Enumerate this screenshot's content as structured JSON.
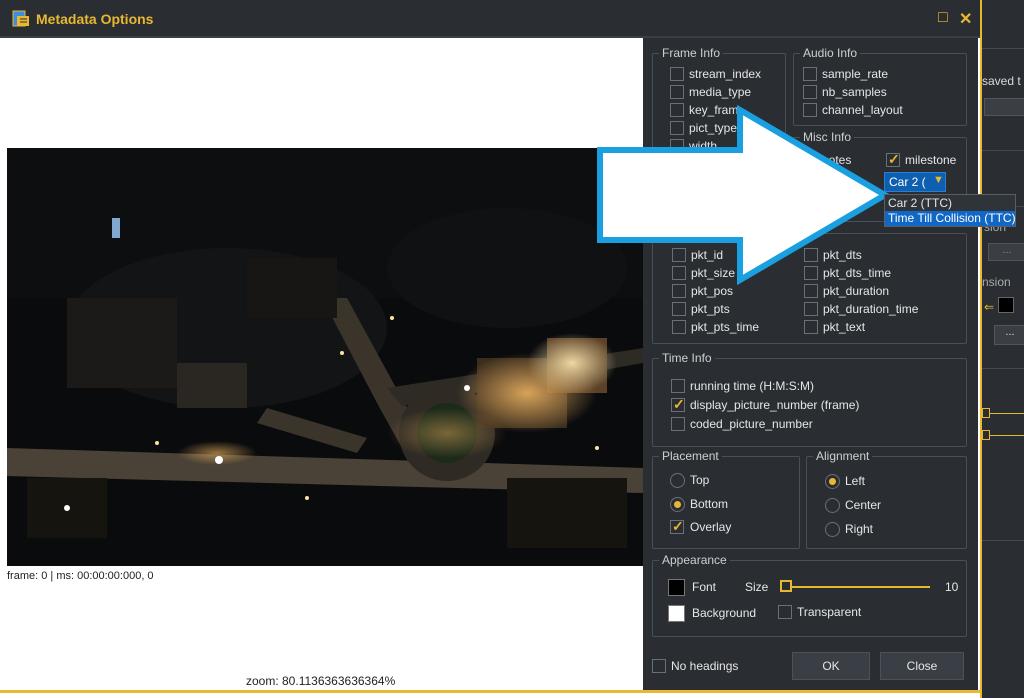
{
  "window": {
    "title": "Metadata Options",
    "maximize_glyph": "□",
    "close_glyph": "✕",
    "icon": "document-icon"
  },
  "background_app": {
    "saved_text": "saved t",
    "sion_text": "sion",
    "nsion_text": "nsion",
    "dots_1": "...",
    "dots_2": "..."
  },
  "preview": {
    "frame_info": "frame: 0 | ms: 00:00:00:000, 0",
    "zoom": "zoom: 80.1136363636364%"
  },
  "frame_info": {
    "heading": "Frame Info",
    "items": [
      {
        "label": "stream_index",
        "checked": false
      },
      {
        "label": "media_type",
        "checked": false
      },
      {
        "label": "key_fram",
        "checked": false
      },
      {
        "label": "pict_type",
        "checked": false
      },
      {
        "label": "width",
        "checked": false
      }
    ]
  },
  "audio_info": {
    "heading": "Audio Info",
    "items": [
      {
        "label": "sample_rate",
        "checked": false
      },
      {
        "label": "nb_samples",
        "checked": false
      },
      {
        "label": "channel_layout",
        "checked": false
      }
    ]
  },
  "misc_info": {
    "heading": "Misc Info",
    "notes_label": "notes",
    "milestone_label": "milestone",
    "milestone_checked": true,
    "dropdown_value": "Car 2 (",
    "dropdown_options": [
      "Car 2 (TTC)",
      "Time Till Collision (TTC)"
    ],
    "selected_option_index": 1
  },
  "packet_info": {
    "left": [
      {
        "label": "pkt_id",
        "checked": false
      },
      {
        "label": "pkt_size",
        "checked": false
      },
      {
        "label": "pkt_pos",
        "checked": false
      },
      {
        "label": "pkt_pts",
        "checked": false
      },
      {
        "label": "pkt_pts_time",
        "checked": false
      }
    ],
    "right": [
      {
        "label": "pkt_dts",
        "checked": false
      },
      {
        "label": "pkt_dts_time",
        "checked": false
      },
      {
        "label": "pkt_duration",
        "checked": false
      },
      {
        "label": "pkt_duration_time",
        "checked": false
      },
      {
        "label": "pkt_text",
        "checked": false
      }
    ]
  },
  "time_info": {
    "heading": "Time Info",
    "items": [
      {
        "label": "running time (H:M:S:M)",
        "checked": false
      },
      {
        "label": "display_picture_number (frame)",
        "checked": true
      },
      {
        "label": "coded_picture_number",
        "checked": false
      }
    ]
  },
  "placement": {
    "heading": "Placement",
    "options": [
      {
        "label": "Top",
        "selected": false
      },
      {
        "label": "Bottom",
        "selected": true
      }
    ],
    "overlay_label": "Overlay",
    "overlay_checked": true
  },
  "alignment": {
    "heading": "Alignment",
    "options": [
      {
        "label": "Left",
        "selected": true
      },
      {
        "label": "Center",
        "selected": false
      },
      {
        "label": "Right",
        "selected": false
      }
    ]
  },
  "appearance": {
    "heading": "Appearance",
    "font_label": "Font",
    "size_label": "Size",
    "size_value": "10",
    "background_label": "Background",
    "transparent_label": "Transparent",
    "transparent_checked": false
  },
  "footer": {
    "no_headings_label": "No headings",
    "ok_label": "OK",
    "close_label": "Close"
  },
  "colors": {
    "accent": "#e8b830",
    "panel": "#2a2e33",
    "highlight": "#1167c6",
    "arrow_border": "#1a9fe0"
  }
}
